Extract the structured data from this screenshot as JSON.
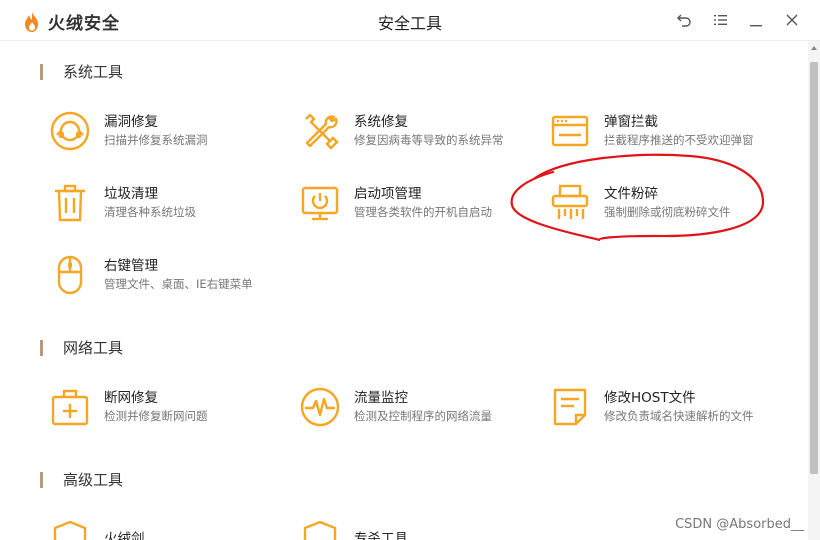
{
  "app": {
    "name": "火绒安全",
    "window_title": "安全工具"
  },
  "sections": [
    {
      "title": "系统工具",
      "tools": [
        {
          "name": "漏洞修复",
          "desc": "扫描并修复系统漏洞",
          "icon": "lifebuoy-icon"
        },
        {
          "name": "系统修复",
          "desc": "修复因病毒等导致的系统异常",
          "icon": "wrench-screwdriver-icon"
        },
        {
          "name": "弹窗拦截",
          "desc": "拦截程序推送的不受欢迎弹窗",
          "icon": "popup-window-icon"
        },
        {
          "name": "垃圾清理",
          "desc": "清理各种系统垃圾",
          "icon": "trash-icon"
        },
        {
          "name": "启动项管理",
          "desc": "管理各类软件的开机自启动",
          "icon": "monitor-power-icon"
        },
        {
          "name": "文件粉碎",
          "desc": "强制删除或彻底粉碎文件",
          "icon": "shredder-icon"
        },
        {
          "name": "右键管理",
          "desc": "管理文件、桌面、IE右键菜单",
          "icon": "mouse-icon"
        }
      ]
    },
    {
      "title": "网络工具",
      "tools": [
        {
          "name": "断网修复",
          "desc": "检测并修复断网问题",
          "icon": "first-aid-kit-icon"
        },
        {
          "name": "流量监控",
          "desc": "检测及控制程序的网络流量",
          "icon": "pulse-icon"
        },
        {
          "name": "修改HOST文件",
          "desc": "修改负责域名快速解析的文件",
          "icon": "document-icon"
        }
      ]
    },
    {
      "title": "高级工具",
      "tools": [
        {
          "name": "火绒剑",
          "icon": "shield-icon"
        },
        {
          "name": "专杀工具",
          "icon": "shield-icon"
        }
      ]
    }
  ],
  "watermark": "CSDN @Absorbed__",
  "colors": {
    "accent": "#f5a623",
    "logo": "#f08a24",
    "section_bar": "#b89a7d",
    "annotation": "#e0151a"
  }
}
